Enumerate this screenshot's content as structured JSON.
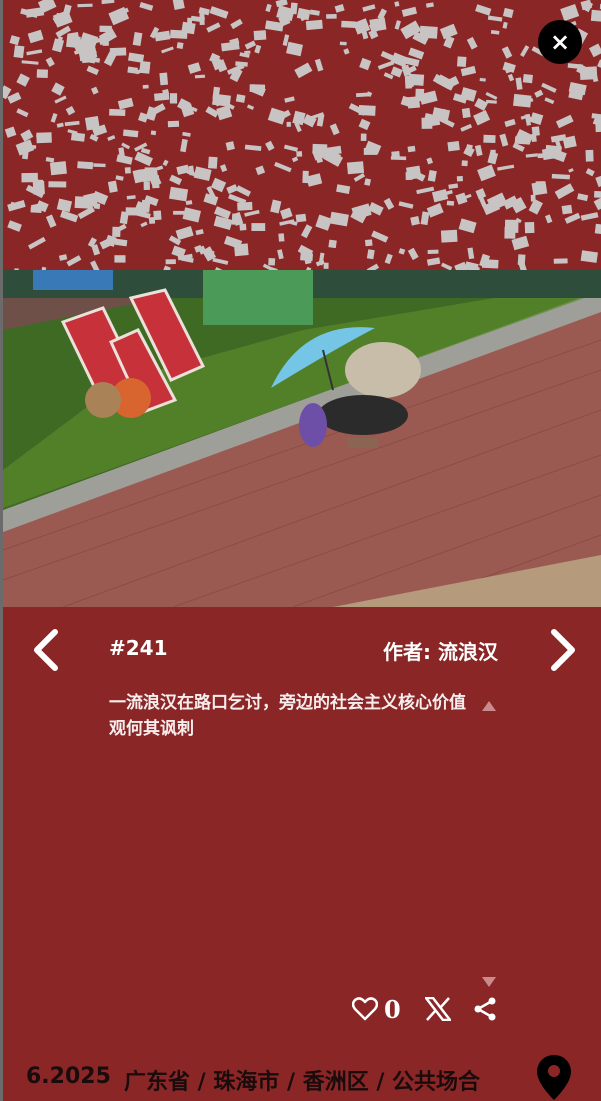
{
  "close_button": {
    "label": "×"
  },
  "post": {
    "id": "#241",
    "author": "作者: 流浪汉",
    "description": "一流浪汉在路口乞讨，旁边的社会主义核心价值观何其讽刺",
    "likes": "0"
  },
  "footer": {
    "date": "6.2025",
    "location": "广东省 / 珠海市 / 香洲区 / 公共场合"
  },
  "colors": {
    "background": "#8b2627",
    "map_buildings": "#c9c4c4",
    "text": "#ffffff",
    "footer_text": "#1a0c0c"
  },
  "icons": {
    "close": "close-icon",
    "prev": "chevron-left-icon",
    "next": "chevron-right-icon",
    "like": "heart-icon",
    "x": "x-logo-icon",
    "share": "share-icon",
    "location": "map-pin-icon"
  }
}
